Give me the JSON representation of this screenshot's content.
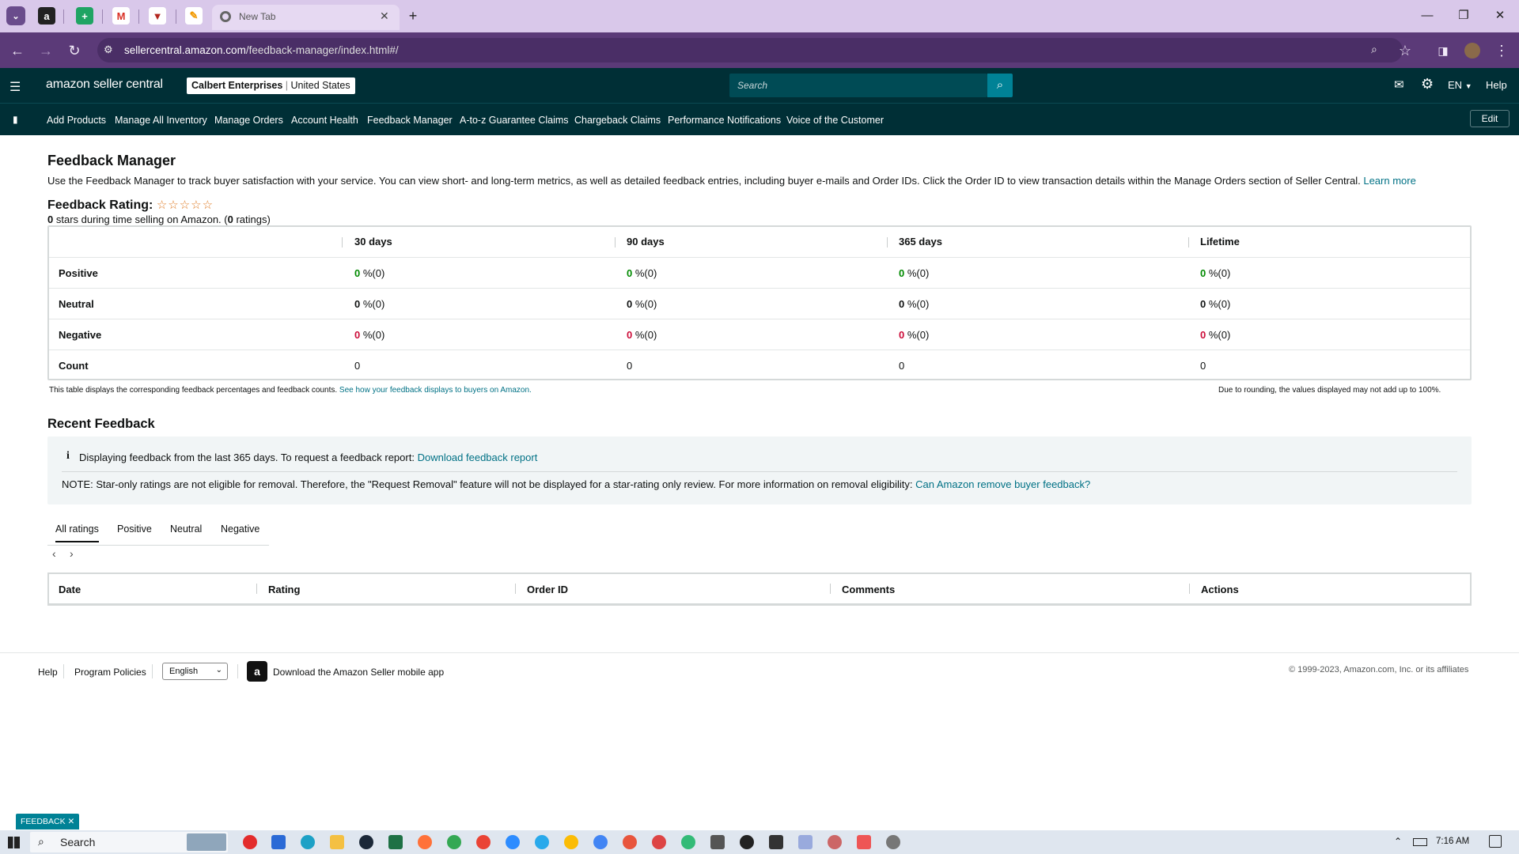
{
  "browser": {
    "tab_title": "New Tab",
    "url_host": "sellercentral.amazon.com",
    "url_path": "/feedback-manager/index.html#/"
  },
  "header": {
    "logo": "amazon seller central",
    "account_name": "Calbert Enterprises",
    "marketplace": "United States",
    "search_placeholder": "Search",
    "language": "EN",
    "help": "Help"
  },
  "nav": {
    "items": [
      "Add Products",
      "Manage All Inventory",
      "Manage Orders",
      "Account Health",
      "Feedback Manager",
      "A-to-z Guarantee Claims",
      "Chargeback Claims",
      "Performance Notifications",
      "Voice of the Customer"
    ],
    "edit": "Edit"
  },
  "page": {
    "title": "Feedback Manager",
    "description": "Use the Feedback Manager to track buyer satisfaction with your service. You can view short- and long-term metrics, as well as detailed feedback entries, including buyer e-mails and Order IDs. Click the Order ID to view transaction details within the Manage Orders section of Seller Central.",
    "learn_more": "Learn more",
    "rating_label": "Feedback Rating:",
    "rating_stars": 0,
    "rating_summary_count": "0",
    "rating_summary_text": " stars during time selling on Amazon. (",
    "rating_summary_ratings": "0",
    "rating_summary_tail": " ratings)"
  },
  "ratings_table": {
    "columns": [
      "30 days",
      "90 days",
      "365 days",
      "Lifetime"
    ],
    "rows": [
      {
        "label": "Positive",
        "values": [
          "0",
          "0",
          "0",
          "0"
        ],
        "suffix": "%(0)"
      },
      {
        "label": "Neutral",
        "values": [
          "0",
          "0",
          "0",
          "0"
        ],
        "suffix": "%(0)"
      },
      {
        "label": "Negative",
        "values": [
          "0",
          "0",
          "0",
          "0"
        ],
        "suffix": "%(0)"
      },
      {
        "label": "Count",
        "values": [
          "0",
          "0",
          "0",
          "0"
        ],
        "suffix": ""
      }
    ],
    "note": "This table displays the corresponding feedback percentages and feedback counts.",
    "note_link": "See how your feedback displays to buyers on Amazon.",
    "rounding_note": "Due to rounding, the values displayed may not add up to 100%."
  },
  "recent": {
    "title": "Recent Feedback",
    "info_text": "Displaying feedback from the last 365 days. To request a feedback report:",
    "info_link": "Download feedback report",
    "note_text": "NOTE: Star-only ratings are not eligible for removal. Therefore, the \"Request Removal\" feature will not be displayed for a star-rating only review. For more information on removal eligibility:",
    "note_link": "Can Amazon remove buyer feedback?",
    "tabs": [
      "All ratings",
      "Positive",
      "Neutral",
      "Negative"
    ],
    "selected_tab": "All ratings",
    "columns": [
      "Date",
      "Rating",
      "Order ID",
      "Comments",
      "Actions"
    ]
  },
  "footer": {
    "help": "Help",
    "program_policies": "Program Policies",
    "language": "English",
    "app_text": "Download the Amazon Seller mobile app",
    "copyright": "© 1999-2023, Amazon.com, Inc. or its affiliates"
  },
  "feedback_button": "FEEDBACK",
  "taskbar": {
    "search": "Search",
    "time": "7:16 AM"
  },
  "colors": {
    "header_bg": "#002f36",
    "search_btn": "#008296",
    "positive": "#008a00",
    "negative": "#cc0c39",
    "link": "#007185"
  }
}
